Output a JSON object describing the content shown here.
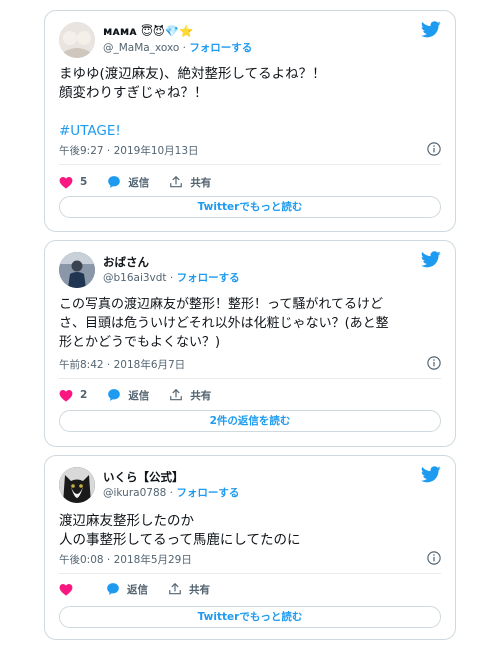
{
  "tweets": [
    {
      "name": "ᴍᴀᴍᴀ",
      "name_emoji": "😇😈💎⭐",
      "handle": "@_MaMa_xoxo",
      "follow_label": "フォローする",
      "text": "まゆゆ(渡辺麻友)、絶対整形してるよね？！\n顔変わりすぎじゃね？！",
      "hashtag": "#UTAGE!",
      "date": "午後9:27 · 2019年10月13日",
      "likes": "5",
      "reply_label": "返信",
      "share_label": "共有",
      "button_label": "Twitterでもっと読む"
    },
    {
      "name": "おばさん",
      "handle": "@b16ai3vdt",
      "follow_label": "フォローする",
      "text": "この写真の渡辺麻友が整形！整形！って騒がれてるけど\nさ、目頭は危ういけどそれ以外は化粧じゃない？(あと整\n形とかどうでもよくない？)",
      "date": "午前8:42 · 2018年6月7日",
      "likes": "2",
      "reply_label": "返信",
      "share_label": "共有",
      "button_label": "2件の返信を読む"
    },
    {
      "name": "いくら【公式】",
      "handle": "@ikura0788",
      "follow_label": "フォローする",
      "text": "渡辺麻友整形したのか\n人の事整形してるって馬鹿にしてたのに",
      "date": "午後0:08 · 2018年5月29日",
      "likes": "",
      "reply_label": "返信",
      "share_label": "共有",
      "button_label": "Twitterでもっと読む"
    }
  ],
  "separator": " · ",
  "colors": {
    "accent": "#1d9bf0",
    "like": "#f91880",
    "muted": "#536471",
    "border": "#cfd9de"
  },
  "icons": [
    "twitter-bird-icon",
    "heart-icon",
    "reply-bubble-icon",
    "share-icon",
    "info-icon"
  ]
}
